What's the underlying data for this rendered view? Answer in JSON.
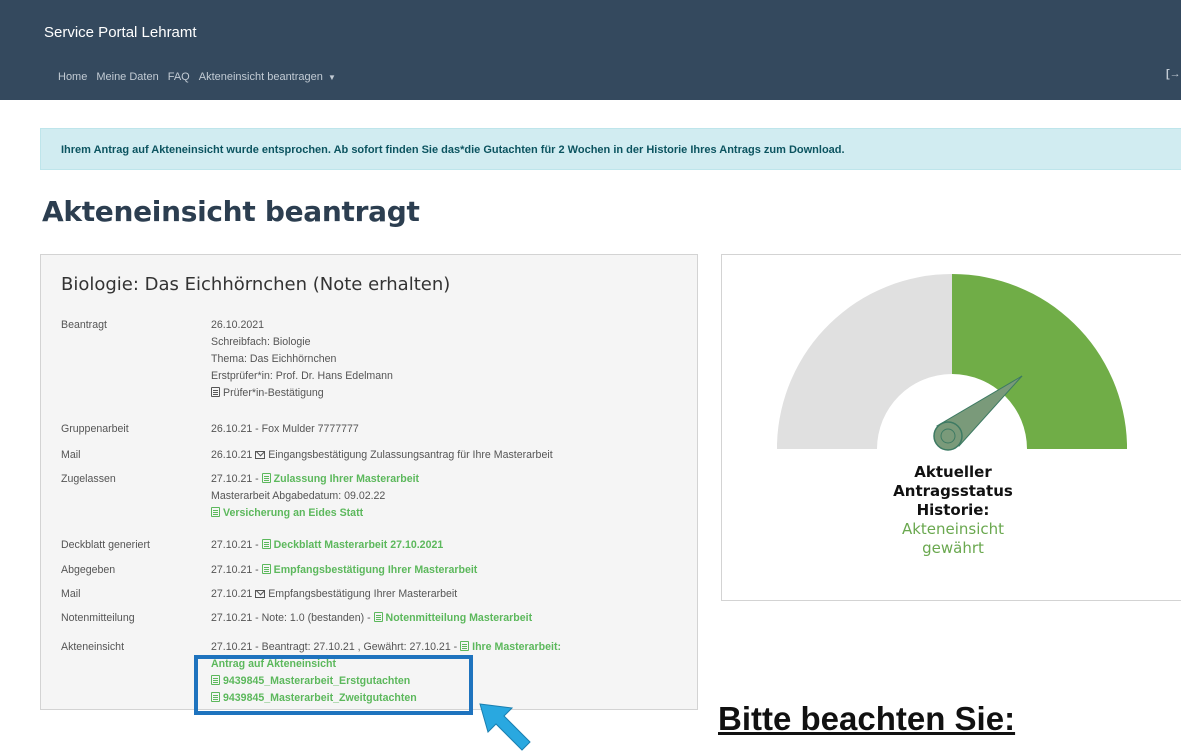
{
  "navbar": {
    "brand": "Service Portal Lehramt",
    "links": [
      "Home",
      "Meine Daten",
      "FAQ",
      "Akteneinsicht beantragen"
    ],
    "dropdown_caret": "▼",
    "logout_icon": "logout-icon"
  },
  "alert": {
    "text": "Ihrem Antrag auf Akteneinsicht wurde entsprochen. Ab sofort finden Sie das*die Gutachten für 2 Wochen in der Historie Ihres Antrags zum Download."
  },
  "page_title": "Akteneinsicht beantragt",
  "card": {
    "title": "Biologie: Das Eichhörnchen (Note erhalten)",
    "rows": [
      {
        "label": "Beantragt",
        "lines": [
          "26.10.2021",
          "Schreibfach: Biologie",
          "Thema: Das Eichhörnchen",
          "Erstprüfer*in: Prof. Dr. Hans Edelmann"
        ],
        "link": "Prüfer*in-Bestätigung"
      },
      {
        "label": "Gruppenarbeit",
        "text": "26.10.21 - Fox Mulder 7777777"
      },
      {
        "label": "Mail",
        "text": "26.10.21",
        "mail_text": "Eingangsbestätigung Zulassungsantrag für Ihre Masterarbeit"
      },
      {
        "label": "Zugelassen",
        "prefix": "27.10.21 - ",
        "link": "Zulassung Ihrer Masterarbeit",
        "line2": "Masterarbeit Abgabedatum: 09.02.22",
        "link2": "Versicherung an Eides Statt"
      },
      {
        "label": "Deckblatt generiert",
        "prefix": "27.10.21 - ",
        "link": "Deckblatt Masterarbeit 27.10.2021"
      },
      {
        "label": "Abgegeben",
        "prefix": "27.10.21 - ",
        "link": "Empfangsbestätigung Ihrer Masterarbeit"
      },
      {
        "label": "Mail",
        "text": "27.10.21",
        "mail_text": "Empfangsbestätigung Ihrer Masterarbeit"
      },
      {
        "label": "Notenmitteilung",
        "prefix": "27.10.21 - Note: 1.0 (bestanden) - ",
        "link": "Notenmitteilung Masterarbeit"
      },
      {
        "label": "Akteneinsicht",
        "prefix": "27.10.21 - Beantragt: 27.10.21 , Gewährt: 27.10.21 - ",
        "link": "Ihre Masterarbeit:",
        "link_cont": "Antrag auf Akteneinsicht",
        "files": [
          "9439845_Masterarbeit_Erstgutachten",
          "9439845_Masterarbeit_Zweitgutachten"
        ]
      }
    ]
  },
  "status": {
    "line1": "Aktueller",
    "line2": "Antragsstatus",
    "line3": "Historie:",
    "line4": "Akteneinsicht",
    "line5": "gewährt",
    "gauge_fraction": 0.8,
    "colors": {
      "filled": "#70ad47",
      "empty": "#e0e0e0",
      "needle": "#7a9a7a"
    }
  },
  "note": "Bitte beachten Sie:",
  "colors": {
    "navbar": "#34495e",
    "alert_bg": "#d1ecf1",
    "link_green": "#5cb85c",
    "highlight": "#1e73be"
  }
}
